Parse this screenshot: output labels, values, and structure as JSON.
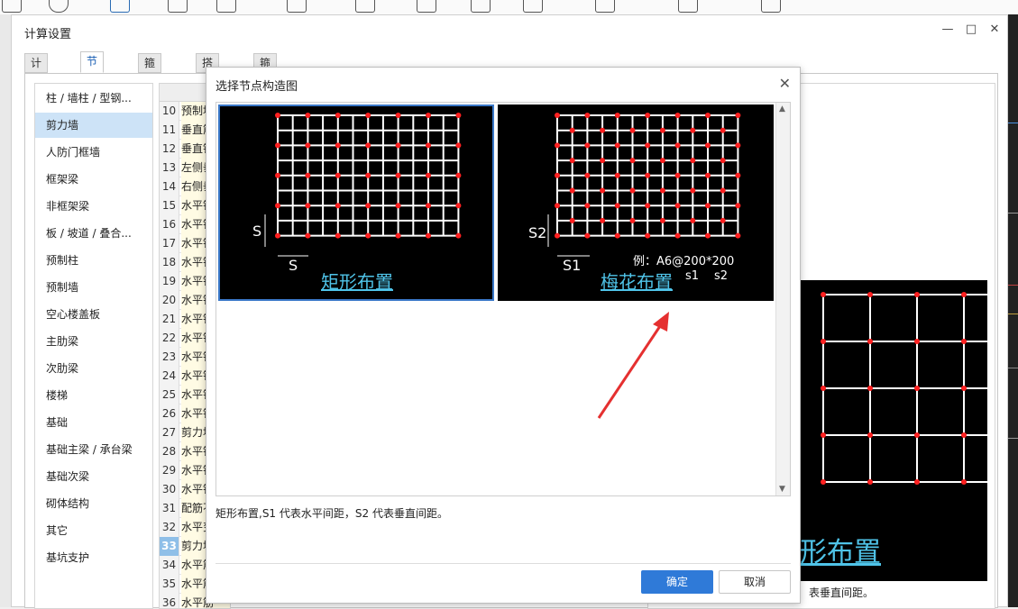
{
  "main_window": {
    "title": "计算设置",
    "tabs": [
      "计算规则",
      "节点设置",
      "箍筋设置",
      "搭接设置",
      "箍筋公式"
    ],
    "active_tab": 1,
    "categories": [
      "柱 / 墙柱 / 型钢...",
      "剪力墙",
      "人防门框墙",
      "框架梁",
      "非框架梁",
      "板 / 坡道 / 叠合...",
      "预制柱",
      "预制墙",
      "空心楼盖板",
      "主肋梁",
      "次肋梁",
      "楼梯",
      "基础",
      "基础主梁 / 承台梁",
      "基础次梁",
      "砌体结构",
      "其它",
      "基坑支护"
    ],
    "selected_category": 1,
    "rows": [
      {
        "num": "10",
        "text": "预制墙"
      },
      {
        "num": "11",
        "text": "垂直筋"
      },
      {
        "num": "12",
        "text": "垂直钢"
      },
      {
        "num": "13",
        "text": "左侧垂"
      },
      {
        "num": "14",
        "text": "右侧垂"
      },
      {
        "num": "15",
        "text": "水平钢"
      },
      {
        "num": "16",
        "text": "水平钢"
      },
      {
        "num": "17",
        "text": "水平钢"
      },
      {
        "num": "18",
        "text": "水平钢"
      },
      {
        "num": "19",
        "text": "水平钢"
      },
      {
        "num": "20",
        "text": "水平钢"
      },
      {
        "num": "21",
        "text": "水平钢"
      },
      {
        "num": "22",
        "text": "水平钢"
      },
      {
        "num": "23",
        "text": "水平钢"
      },
      {
        "num": "24",
        "text": "水平钢"
      },
      {
        "num": "25",
        "text": "水平钢"
      },
      {
        "num": "26",
        "text": "水平钢"
      },
      {
        "num": "27",
        "text": "剪力墙"
      },
      {
        "num": "28",
        "text": "水平钢"
      },
      {
        "num": "29",
        "text": "水平钢"
      },
      {
        "num": "30",
        "text": "水平钢"
      },
      {
        "num": "31",
        "text": "配筋不"
      },
      {
        "num": "32",
        "text": "水平变"
      },
      {
        "num": "33",
        "text": "剪力墙"
      },
      {
        "num": "34",
        "text": "水平筋"
      },
      {
        "num": "35",
        "text": "水平筋"
      },
      {
        "num": "36",
        "text": "水平筋"
      }
    ],
    "selected_row": "33",
    "background_preview": {
      "caption": "形布置",
      "description": "表垂直间距。"
    }
  },
  "dialog": {
    "title": "选择节点构造图",
    "options": [
      {
        "caption": "矩形布置",
        "label_v": "S",
        "label_h": "S"
      },
      {
        "caption": "梅花布置",
        "label_v": "S2",
        "label_h": "S1",
        "example": "例：A6@200*200",
        "s1": "s1",
        "s2": "s2"
      }
    ],
    "selected_option": 0,
    "description": "矩形布置,S1 代表水平间距，S2 代表垂直间距。",
    "ok_label": "确定",
    "cancel_label": "取消"
  },
  "colors": {
    "accent": "#2f7ad8",
    "caption_cyan": "#4fc3e8",
    "rebar_dot": "#ff2020",
    "annotation_arrow": "#e53030"
  }
}
